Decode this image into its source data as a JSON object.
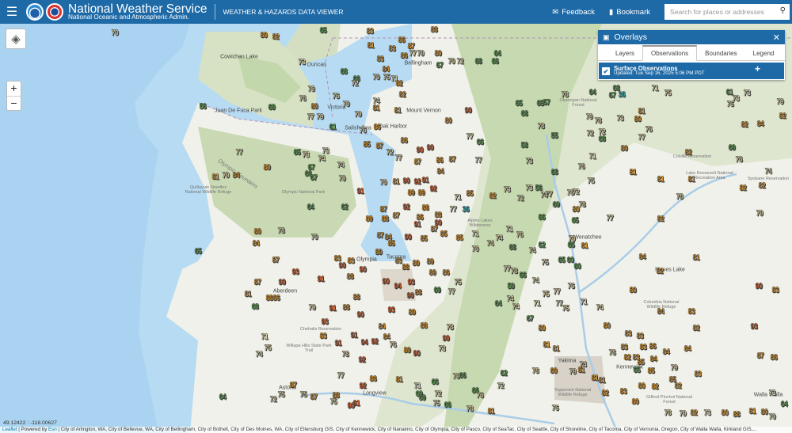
{
  "header": {
    "menu_icon": "hamburger-icon",
    "title": "National Weather Service",
    "subtitle": "National Oceanic and Atmospheric Admin.",
    "viewer": "WEATHER & HAZARDS DATA VIEWER",
    "feedback": "Feedback",
    "bookmark": "Bookmark",
    "search_placeholder": "Search for places or addresses"
  },
  "colors": {
    "header": "#1e6aa7",
    "cold": "#36c4c9",
    "cool": "#5faa4f",
    "mild": "#f4e9b3",
    "warm": "#f0a22b",
    "hot": "#e8622a"
  },
  "overlays": {
    "title": "Overlays",
    "tabs": [
      "Layers",
      "Observations",
      "Boundaries",
      "Legend"
    ],
    "active_tab": "Observations",
    "layer": {
      "name": "Surface Observations",
      "updated": "Updated: Tue Sep 16, 2025 5:06 PM PDT",
      "checked": true
    }
  },
  "map": {
    "zoom_in": "+",
    "zoom_out": "−",
    "cities": [
      "Bellingham",
      "Mount Vernon",
      "Oak Harbor",
      "Victoria",
      "Duncan",
      "Salish Sea",
      "Tacoma",
      "Olympia",
      "Aberdeen",
      "Longview",
      "Astoria",
      "Wenatchee",
      "Moses Lake",
      "Yakima",
      "Kennewick",
      "Walla Walla",
      "Juan De Fuca Park",
      "Cowichan Lake",
      "Olympic Mountains"
    ],
    "parks": [
      "Olympic National Park",
      "Quillayute Needles National Wildlife Refuge",
      "Chehalis Reservation",
      "Willapa Hills State Park Trail",
      "Colville Reservation",
      "Lake Roosevelt National Recreation Area",
      "Spokane Reservation",
      "Columbia National Wildlife Refuge",
      "Okanogan National Forest",
      "Gifford Pinchot National Forest",
      "Toppenish National Wildlife Refuge",
      "Alpine Lakes Wilderness"
    ],
    "observations": [
      70,
      80,
      82,
      65,
      83,
      88,
      86,
      87,
      81,
      83,
      86,
      77,
      79,
      80,
      67,
      70,
      72,
      68,
      66,
      64,
      73,
      83,
      84,
      70,
      75,
      71,
      82,
      82,
      68,
      66,
      72,
      79,
      76,
      76,
      79,
      56,
      69,
      80,
      77,
      79,
      79,
      74,
      81,
      81,
      90,
      80,
      61,
      76,
      86,
      86,
      85,
      87,
      72,
      77,
      90,
      90,
      86,
      87,
      87,
      77,
      84,
      77,
      66,
      77,
      80,
      81,
      79,
      84,
      65,
      73,
      73,
      74,
      74,
      67,
      66,
      67,
      79,
      91,
      70,
      81,
      90,
      92,
      91,
      89,
      89,
      92,
      71,
      85,
      82,
      73,
      62,
      64,
      36,
      77,
      87,
      88,
      92,
      87,
      86,
      88,
      90,
      80,
      84,
      78,
      70,
      88,
      89,
      87,
      84,
      85,
      89,
      83,
      88,
      89,
      89,
      85,
      90,
      91,
      87,
      85,
      85,
      74,
      70,
      71,
      87,
      87,
      90,
      93,
      91,
      83,
      90,
      83,
      88,
      90,
      90,
      94,
      93,
      88,
      90,
      89,
      86,
      75,
      77,
      69,
      81,
      88,
      86,
      68,
      79,
      91,
      88,
      90,
      93,
      88,
      93,
      89,
      84,
      88,
      90,
      73,
      78,
      83,
      91,
      94,
      92,
      91,
      78,
      84,
      76,
      89,
      90,
      92,
      71,
      75,
      74,
      77,
      86,
      92,
      81,
      71,
      66,
      72,
      79,
      66,
      87,
      75,
      72,
      75,
      87,
      75,
      88,
      90,
      91,
      64,
      65,
      69,
      69,
      75,
      66,
      78,
      81,
      78,
      64,
      68,
      67,
      36,
      71,
      75,
      76,
      73,
      61,
      73,
      79,
      82,
      65,
      65,
      57,
      68,
      79,
      78,
      73,
      80,
      81,
      76,
      77,
      78,
      55,
      72,
      72,
      68,
      58,
      80,
      82,
      69,
      76,
      82,
      84,
      73,
      71,
      76,
      68,
      75,
      81,
      81,
      81,
      82,
      82,
      74,
      78,
      79,
      73,
      56,
      77,
      74,
      76,
      72,
      72,
      69,
      80,
      78,
      66,
      65,
      77,
      82,
      71,
      76,
      74,
      68,
      62,
      74,
      65,
      70,
      81,
      84,
      81,
      75,
      65,
      60,
      60,
      82,
      77,
      78,
      66,
      74,
      59,
      76,
      75,
      77,
      80,
      90,
      83,
      64,
      74,
      74,
      71,
      77,
      75,
      71,
      74,
      84,
      83,
      67,
      80,
      80,
      83,
      83,
      82,
      93,
      81,
      81,
      83,
      83,
      86,
      78,
      82,
      83,
      85,
      84,
      84,
      84,
      87,
      86,
      74,
      65,
      85,
      79,
      83,
      62,
      78,
      80,
      79,
      81,
      81,
      81,
      85,
      72,
      80,
      82,
      82,
      82,
      83,
      66,
      76,
      80,
      73,
      64,
      76,
      78,
      79,
      82,
      80,
      88,
      81,
      80,
      70,
      73
    ]
  },
  "status": {
    "coordinates": "49.12422 : -118.00627"
  },
  "attribution": {
    "leaflet": "Leaflet",
    "powered": " | Powered by ",
    "esri": "Esri",
    "sources": " | City of Arlington, WA, City of Bellevue, WA, City of Bellingham, City of Bothell, City of Des Moines, WA, City of Ellensburg GIS, City of Kennewick, City of Nanaimo, City of Olympia, City of Pasco, City of SeaTac, City of Seattle, City of Shoreline, City of Tacoma, City of Vernonia, Oregon, City of Walla Walla, Kirkland GIS,..."
  }
}
